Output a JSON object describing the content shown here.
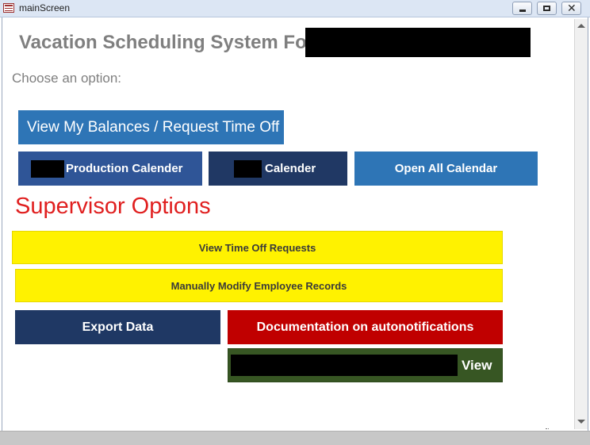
{
  "window": {
    "title": "mainScreen",
    "controls": {
      "minimize": "",
      "maximize": "",
      "close": "✕"
    }
  },
  "main": {
    "heading": "Vacation Scheduling System For",
    "prompt": "Choose an option:",
    "buttons": {
      "balances": "View My Balances / Request Time Off",
      "production_calendar": "Production Calender",
      "calendar": "Calender",
      "open_all_calendar": "Open All Calendar"
    }
  },
  "supervisor": {
    "heading": "Supervisor Options",
    "buttons": {
      "time_off_requests": "View Time Off Requests",
      "modify_records": "Manually Modify Employee Records",
      "export_data": "Export Data",
      "documentation": "Documentation on autonotifications",
      "view": "View"
    }
  },
  "icons": {
    "app": "form-icon",
    "scroll_up": "scroll-up-arrow-icon",
    "scroll_down": "scroll-down-arrow-icon"
  },
  "colors": {
    "heading_gray": "#7f7f7f",
    "supervisor_red": "#e01f1f",
    "blue_button": "#2e75b6",
    "dark_blue_button": "#2f5597",
    "navy_button": "#203864",
    "yellow_button": "#fff200",
    "red_button": "#c00000",
    "green_button": "#375623"
  }
}
